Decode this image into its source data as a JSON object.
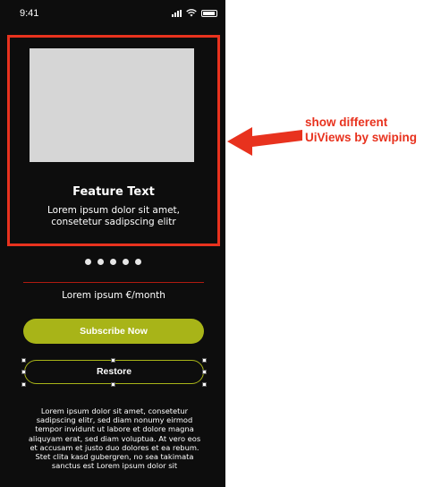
{
  "status_bar": {
    "time": "9:41",
    "icons": [
      "signal-icon",
      "wifi-icon",
      "battery-icon"
    ]
  },
  "carousel": {
    "feature_title": "Feature Text",
    "feature_description": "Lorem ipsum dolor sit amet, consetetur sadipscing elitr",
    "page_count": 5,
    "image_placeholder_color": "#d6d6d6",
    "frame_color": "#e8321e"
  },
  "pricing": {
    "price_text": "Lorem ipsum €/month"
  },
  "buttons": {
    "subscribe_label": "Subscribe Now",
    "restore_label": "Restore",
    "accent_color": "#a8b418"
  },
  "footer": {
    "body_text": "Lorem ipsum dolor sit amet, consetetur sadipscing elitr, sed diam nonumy eirmod tempor invidunt ut labore et dolore magna aliquyam erat, sed diam voluptua. At vero eos et accusam et justo duo dolores et ea rebum. Stet clita kasd gubergren, no sea takimata sanctus est Lorem ipsum dolor sit"
  },
  "annotation": {
    "text_line1": "show different",
    "text_line2": "UiViews by swiping",
    "color": "#e8321e"
  }
}
